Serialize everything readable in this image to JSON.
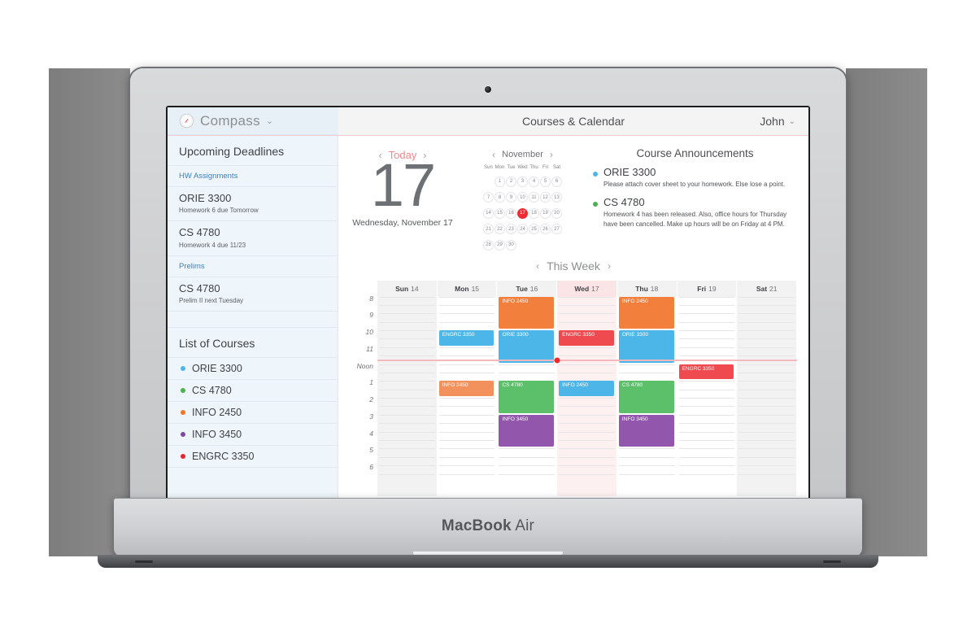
{
  "device": {
    "label_bold": "MacBook",
    "label_light": " Air"
  },
  "topbar": {
    "brand_name": "Compass",
    "brand_caret": "⌄",
    "brand_icon": "compass-icon",
    "page_title": "Courses & Calendar",
    "user_name": "John",
    "user_caret": "⌄"
  },
  "sidebar": {
    "deadlines_heading": "Upcoming Deadlines",
    "hw_section_label": "HW Assignments",
    "hw_items": [
      {
        "course": "ORIE 3300",
        "detail": "Homework 6 due Tomorrow"
      },
      {
        "course": "CS 4780",
        "detail": "Homework 4 due 11/23"
      }
    ],
    "prelims_section_label": "Prelims",
    "prelim_items": [
      {
        "course": "CS 4780",
        "detail": "Prelim II next Tuesday"
      }
    ],
    "courses_heading": "List of Courses",
    "courses": [
      {
        "name": "ORIE 3300",
        "color": "#4db6e8"
      },
      {
        "name": "CS 4780",
        "color": "#4caf50"
      },
      {
        "name": "INFO 2450",
        "color": "#f2762e"
      },
      {
        "name": "INFO 3450",
        "color": "#7b4ba3"
      },
      {
        "name": "ENGRC 3350",
        "color": "#e8262f"
      }
    ]
  },
  "today": {
    "nav_prev": "‹",
    "nav_next": "›",
    "label": "Today",
    "day_number": "17",
    "full_date": "Wednesday, November 17"
  },
  "mini_calendar": {
    "nav_prev": "‹",
    "nav_next": "›",
    "month": "November",
    "weekday_headers": [
      "Sun",
      "Mon",
      "Tue",
      "Wed",
      "Thu",
      "Fri",
      "Sat"
    ],
    "weeks": [
      [
        "",
        "1",
        "2",
        "3",
        "4",
        "5",
        "6"
      ],
      [
        "7",
        "8",
        "9",
        "10",
        "11",
        "12",
        "13"
      ],
      [
        "14",
        "15",
        "16",
        "17",
        "18",
        "19",
        "20"
      ],
      [
        "21",
        "22",
        "23",
        "24",
        "25",
        "26",
        "27"
      ],
      [
        "28",
        "29",
        "30",
        "",
        "",
        "",
        ""
      ]
    ],
    "selected_day": "17",
    "selected_color": "#ee2b33"
  },
  "announcements": {
    "title": "Course Announcements",
    "items": [
      {
        "course": "ORIE 3300",
        "color": "#4db6e8",
        "text": "Please attach cover sheet to your homework. Else lose a point."
      },
      {
        "course": "CS 4780",
        "color": "#4caf50",
        "text": "Homework 4 has been released. Also, office hours for Thursday have been cancelled. Make up hours will be on Friday at 4 PM."
      }
    ]
  },
  "week": {
    "nav_prev": "‹",
    "nav_next": "›",
    "label": "This Week",
    "time_labels": [
      "8",
      "9",
      "10",
      "11",
      "Noon",
      "1",
      "2",
      "3",
      "4",
      "5",
      "6"
    ],
    "current_time_color": "#f5b8bc",
    "current_time_dot_color": "#ee2b33",
    "days": [
      {
        "name": "Sun",
        "num": "14",
        "weekend": true,
        "today": false,
        "events": []
      },
      {
        "name": "Mon",
        "num": "15",
        "weekend": false,
        "today": false,
        "events": [
          {
            "title": "ENGRC 3350",
            "color": "#4db6e8",
            "start": 10,
            "end": 11
          },
          {
            "title": "INFO 2450",
            "color": "#f2915c",
            "start": 13,
            "end": 14
          }
        ]
      },
      {
        "name": "Tue",
        "num": "16",
        "weekend": false,
        "today": false,
        "events": [
          {
            "title": "INFO 2450",
            "color": "#f2803c",
            "start": 8,
            "end": 10
          },
          {
            "title": "ORIE 3300",
            "color": "#4db6e8",
            "start": 10,
            "end": 12
          },
          {
            "title": "CS 4780",
            "color": "#5cbf6a",
            "start": 13,
            "end": 15
          },
          {
            "title": "INFO 3450",
            "color": "#9257ac",
            "start": 15,
            "end": 17
          }
        ]
      },
      {
        "name": "Wed",
        "num": "17",
        "weekend": false,
        "today": true,
        "events": [
          {
            "title": "ENGRC 3350",
            "color": "#ee4a4f",
            "start": 10,
            "end": 11
          },
          {
            "title": "INFO 2450",
            "color": "#4db6e8",
            "start": 13,
            "end": 14
          }
        ]
      },
      {
        "name": "Thu",
        "num": "18",
        "weekend": false,
        "today": false,
        "events": [
          {
            "title": "INFO 2450",
            "color": "#f2803c",
            "start": 8,
            "end": 10
          },
          {
            "title": "ORIE 3300",
            "color": "#4db6e8",
            "start": 10,
            "end": 12
          },
          {
            "title": "CS 4780",
            "color": "#5cbf6a",
            "start": 13,
            "end": 15
          },
          {
            "title": "INFO 3450",
            "color": "#9257ac",
            "start": 15,
            "end": 17
          }
        ]
      },
      {
        "name": "Fri",
        "num": "19",
        "weekend": false,
        "today": false,
        "events": [
          {
            "title": "ENGRC 3350",
            "color": "#ee4a4f",
            "start": 12,
            "end": 13
          }
        ]
      },
      {
        "name": "Sat",
        "num": "21",
        "weekend": true,
        "today": false,
        "events": []
      }
    ]
  }
}
